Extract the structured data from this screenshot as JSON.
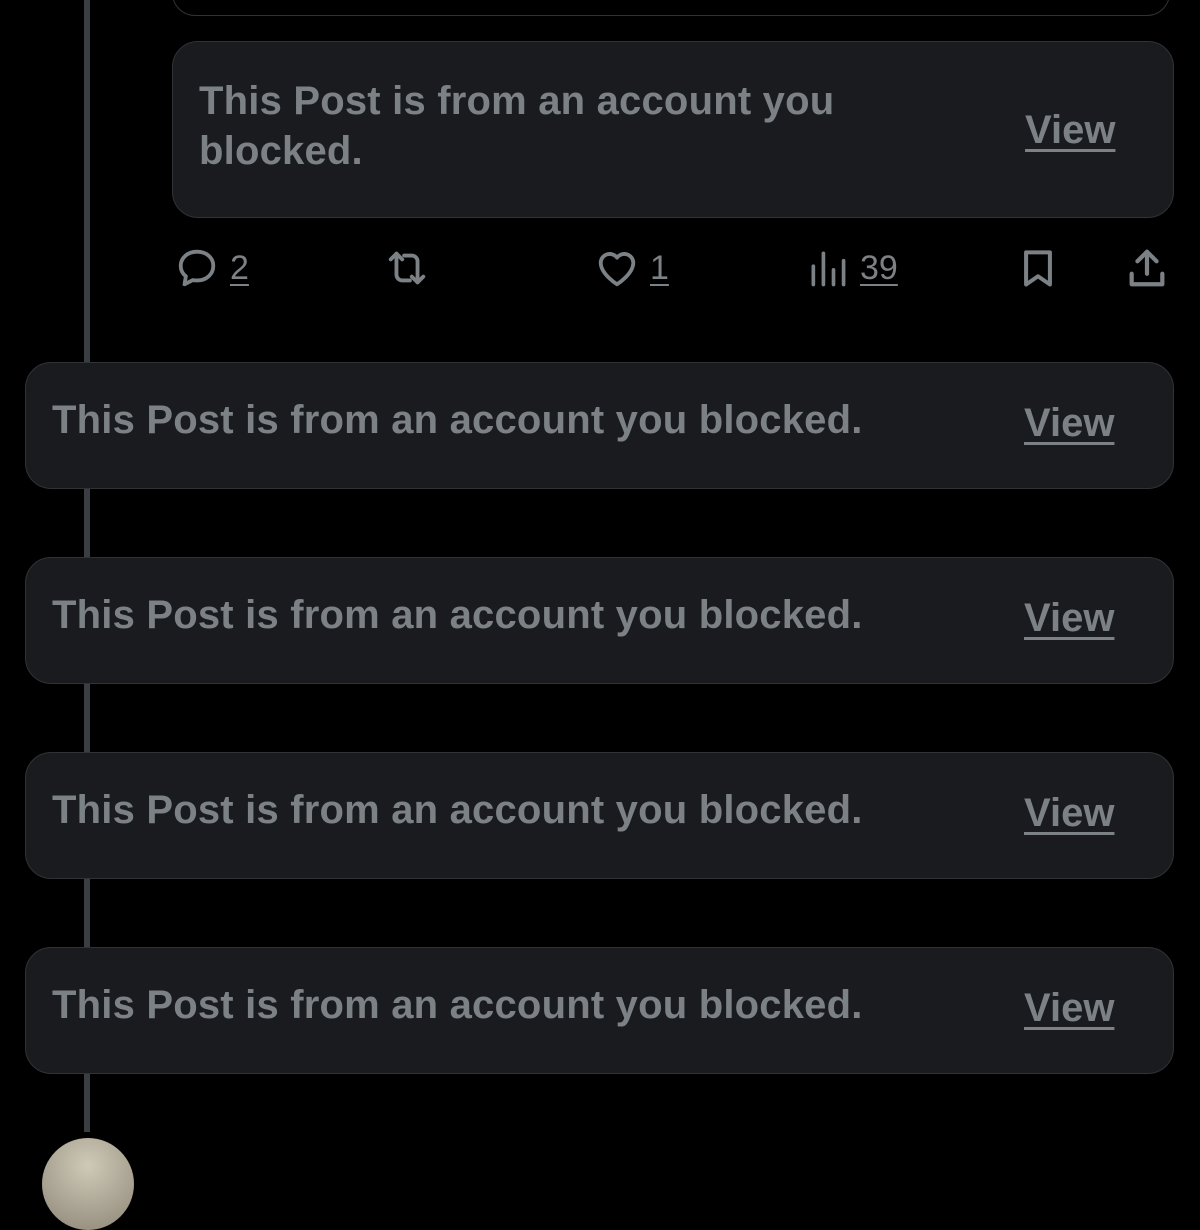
{
  "quoted_post": {
    "message": "This Post is from an account you blocked.",
    "view_label": "View"
  },
  "actions": {
    "reply_count": "2",
    "repost_count": "",
    "like_count": "1",
    "views_count": "39"
  },
  "blocked_replies": [
    {
      "message": "This Post is from an account you blocked.",
      "view_label": "View"
    },
    {
      "message": "This Post is from an account you blocked.",
      "view_label": "View"
    },
    {
      "message": "This Post is from an account you blocked.",
      "view_label": "View"
    },
    {
      "message": "This Post is from an account you blocked.",
      "view_label": "View"
    }
  ],
  "colors": {
    "background": "#000000",
    "card_background": "#1a1b1e",
    "card_border": "#2f3336",
    "text_muted": "#7b8185",
    "thread_line": "#3a3d41"
  }
}
